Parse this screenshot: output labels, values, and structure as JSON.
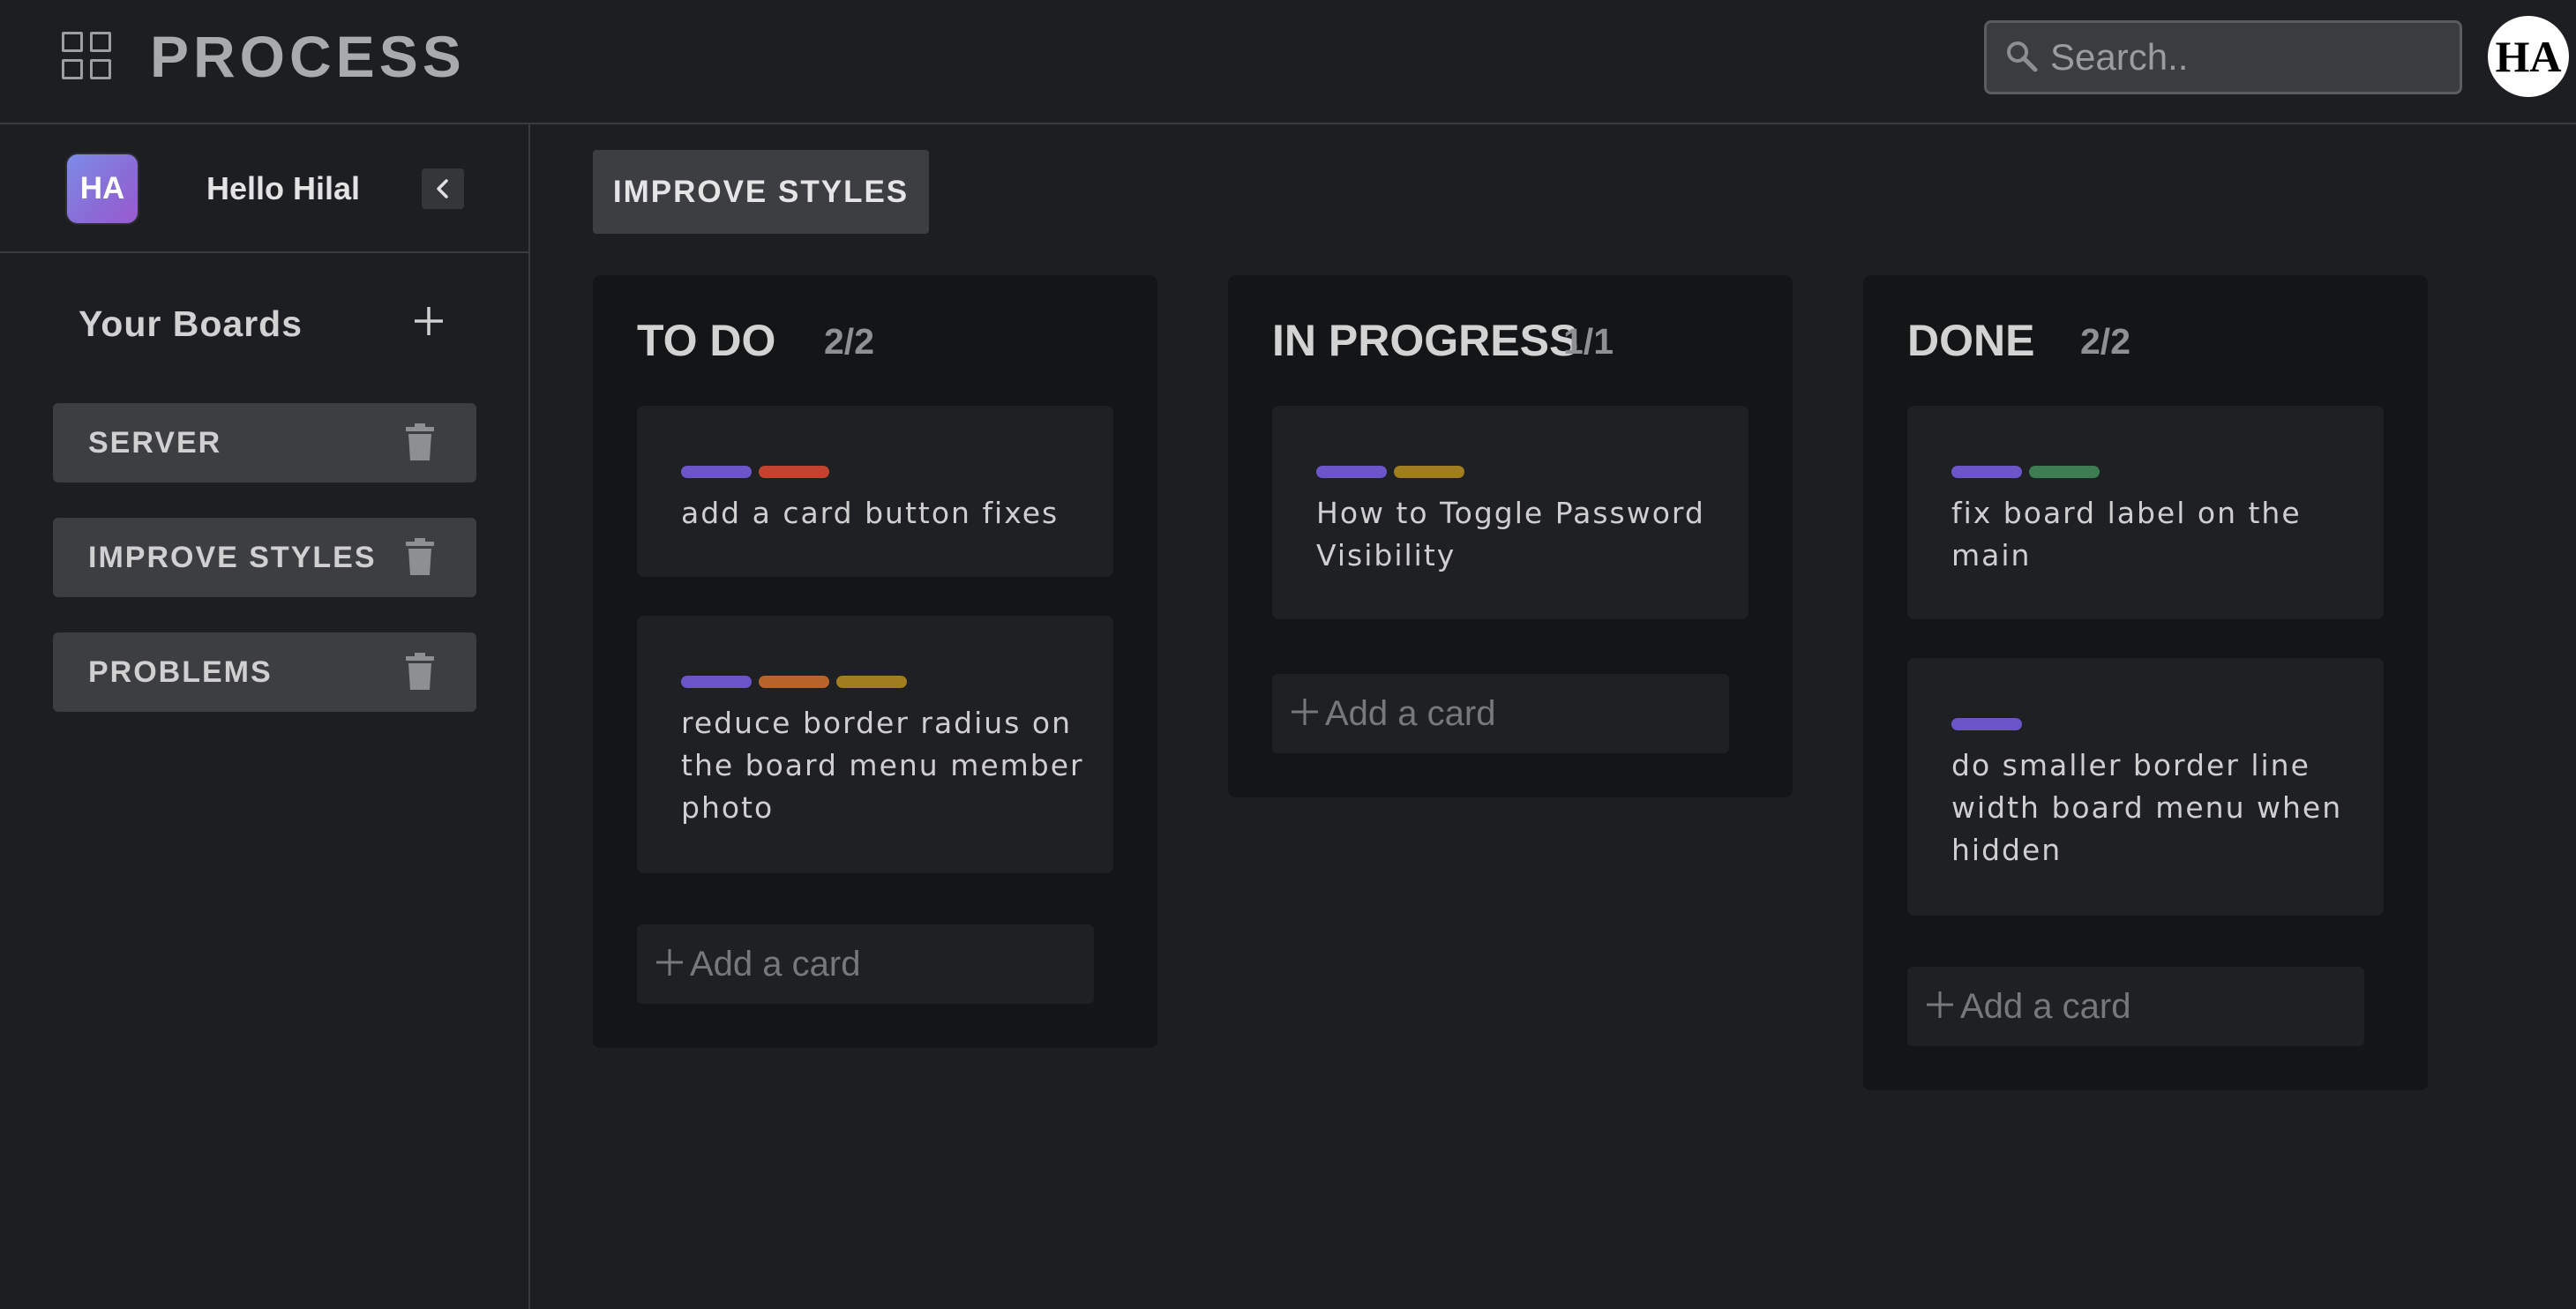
{
  "header": {
    "app_title": "PROCESS",
    "app_icon": "grid-icon",
    "search_placeholder": "Search..",
    "user_initials": "HA"
  },
  "sidebar": {
    "avatar_initials": "HA",
    "greeting": "Hello Hilal",
    "collapse_icon": "chevron-left-icon",
    "boards_title": "Your Boards",
    "add_icon": "plus-icon",
    "boards": [
      {
        "label": "SERVER"
      },
      {
        "label": "IMPROVE STYLES"
      },
      {
        "label": "PROBLEMS"
      }
    ]
  },
  "main": {
    "current_board": "IMPROVE STYLES",
    "columns": [
      {
        "title": "TO DO",
        "count": "2/2",
        "cards": [
          {
            "text": "add a card button fixes",
            "tags": [
              "#6b55c8",
              "#c4432f"
            ]
          },
          {
            "text": "reduce border radius on the board menu member photo",
            "tags": [
              "#6b55c8",
              "#b9642a",
              "#a07d1e"
            ]
          }
        ],
        "add_label": "Add a card"
      },
      {
        "title": "IN PROGRESS",
        "count": "1/1",
        "cards": [
          {
            "text": "How to Toggle Password Visibility",
            "tags": [
              "#6b55c8",
              "#a07d1e"
            ]
          }
        ],
        "add_label": "Add a card"
      },
      {
        "title": "DONE",
        "count": "2/2",
        "cards": [
          {
            "text": "fix board label on the main",
            "tags": [
              "#6b55c8",
              "#3e7d52"
            ]
          },
          {
            "text": "do smaller border line width board menu when hidden",
            "tags": [
              "#6b55c8"
            ]
          }
        ],
        "add_label": "Add a card"
      }
    ]
  }
}
